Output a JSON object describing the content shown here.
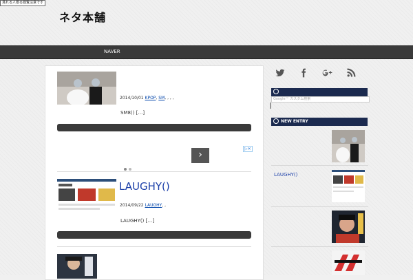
{
  "header": {
    "badge_text": "見れる人限る閲覧注意です",
    "site_title": "ネタ本舗"
  },
  "nav": {
    "items": [
      {
        "label": "NAVER"
      }
    ]
  },
  "posts": [
    {
      "date": "2014/10/01",
      "tags": [
        "KPOP",
        ",",
        "SM",
        ", , , ,"
      ],
      "excerpt": "SM8()  […]"
    },
    {
      "title": "LAUGHY()",
      "date": "2014/09/22",
      "tags": [
        "LAUGHY",
        ", ,"
      ],
      "excerpt": "LAUGHY()  […]"
    }
  ],
  "ad": {
    "next_arrow": "›",
    "adchoices": "▷✕",
    "active_dot": 0
  },
  "sidebar": {
    "search_placeholder": "Google™ カスタム検索",
    "new_entry_heading": "NEW ENTRY",
    "entries": [
      {
        "title": ""
      },
      {
        "title": "LAUGHY()"
      },
      {
        "title": ""
      },
      {
        "title": ""
      }
    ]
  },
  "social": {
    "twitter": "twitter-icon",
    "facebook": "facebook-icon",
    "googleplus": "google-plus-icon",
    "rss": "rss-icon"
  },
  "colors": {
    "nav_bg": "#3a3a3a",
    "panel_head_bg": "#1b2a4f",
    "link": "#1a3ea8"
  }
}
